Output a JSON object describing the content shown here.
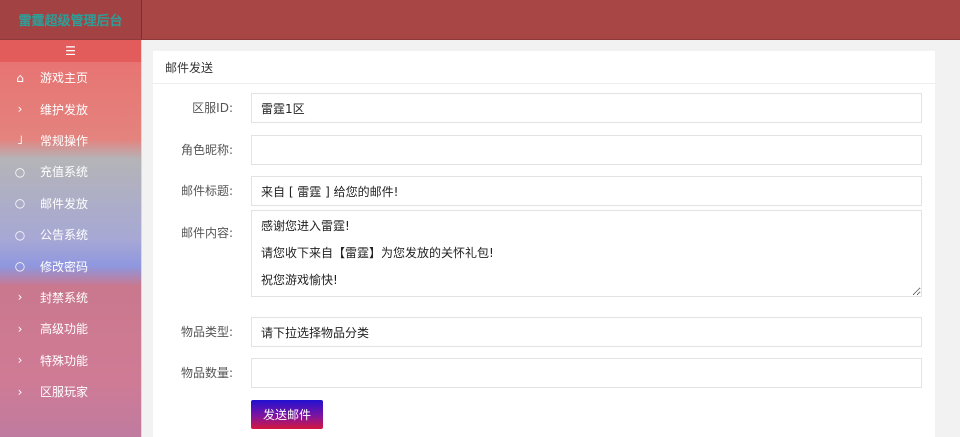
{
  "header": {
    "logo_text": "雷霆超级管理后台"
  },
  "sidebar": {
    "toggle_icon": "menu-toggle-icon",
    "items": [
      {
        "icon": "home-icon",
        "glyph": "⌂",
        "label": "游戏主页"
      },
      {
        "icon": "chevron-right-icon",
        "glyph": "›",
        "label": "维护发放"
      },
      {
        "icon": "expanded-corner-icon",
        "glyph": "˩",
        "label": "常规操作"
      },
      {
        "icon": "circle-icon",
        "glyph": "○",
        "label": "充值系统"
      },
      {
        "icon": "circle-icon",
        "glyph": "○",
        "label": "邮件发放"
      },
      {
        "icon": "circle-icon",
        "glyph": "○",
        "label": "公告系统"
      },
      {
        "icon": "circle-icon",
        "glyph": "○",
        "label": "修改密码"
      },
      {
        "icon": "chevron-right-icon",
        "glyph": "›",
        "label": "封禁系统"
      },
      {
        "icon": "chevron-right-icon",
        "glyph": "›",
        "label": "高级功能"
      },
      {
        "icon": "chevron-right-icon",
        "glyph": "›",
        "label": "特殊功能"
      },
      {
        "icon": "chevron-right-icon",
        "glyph": "›",
        "label": "区服玩家"
      }
    ]
  },
  "form": {
    "title": "邮件发送",
    "server": {
      "label": "区服ID:",
      "value": "雷霆1区"
    },
    "role": {
      "label": "角色昵称:",
      "value": ""
    },
    "subject": {
      "label": "邮件标题:",
      "value": "来自 [ 雷霆 ] 给您的邮件!"
    },
    "content": {
      "label": "邮件内容:",
      "value": "感谢您进入雷霆!\n请您收下来自【雷霆】为您发放的关怀礼包!\n祝您游戏愉快!"
    },
    "item_type": {
      "label": "物品类型:",
      "value": "请下拉选择物品分类"
    },
    "quantity": {
      "label": "物品数量:",
      "value": ""
    },
    "submit_label": "发送邮件"
  }
}
